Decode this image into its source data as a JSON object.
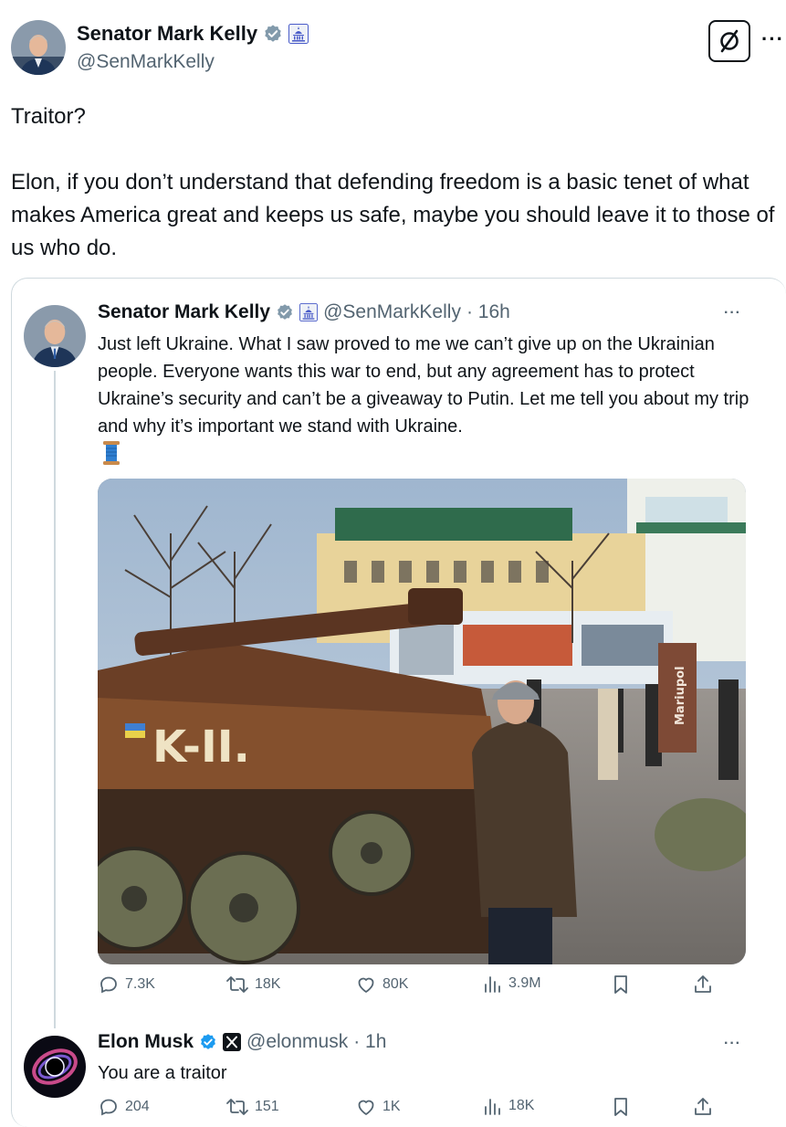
{
  "main_tweet": {
    "author_name": "Senator Mark Kelly",
    "handle": "@SenMarkKelly",
    "text": "Traitor?\n\nElon, if you don’t understand that defending freedom is a basic tenet of what makes America great and keeps us safe, maybe you should leave it to those of us who do.",
    "more_label": "···"
  },
  "quoted_tweet": {
    "author_name": "Senator Mark Kelly",
    "handle": "@SenMarkKelly",
    "time": "· 16h",
    "text": "Just left Ukraine. What I saw proved to me we can’t give up on the Ukrainian people. Everyone wants this war to end, but any agreement has to protect Ukraine’s security and can’t be a giveaway to Putin. Let me tell you about my trip and why it’s important we stand with Ukraine.",
    "emoji_icon": "spool-of-thread-icon",
    "photo_sign_text": "Mariupol",
    "more_label": "···",
    "stats": {
      "replies": "7.3K",
      "reposts": "18K",
      "likes": "80K",
      "views": "3.9M"
    }
  },
  "reply_tweet": {
    "author_name": "Elon Musk",
    "handle": "@elonmusk",
    "time": "· 1h",
    "text": "You are a traitor",
    "more_label": "···",
    "stats": {
      "replies": "204",
      "reposts": "151",
      "likes": "1K",
      "views": "18K"
    }
  },
  "colors": {
    "text": "#0f1419",
    "secondary": "#536471",
    "border": "#cfd9de",
    "verified": "#1d9bf0",
    "gov_badge": "#829aab"
  }
}
